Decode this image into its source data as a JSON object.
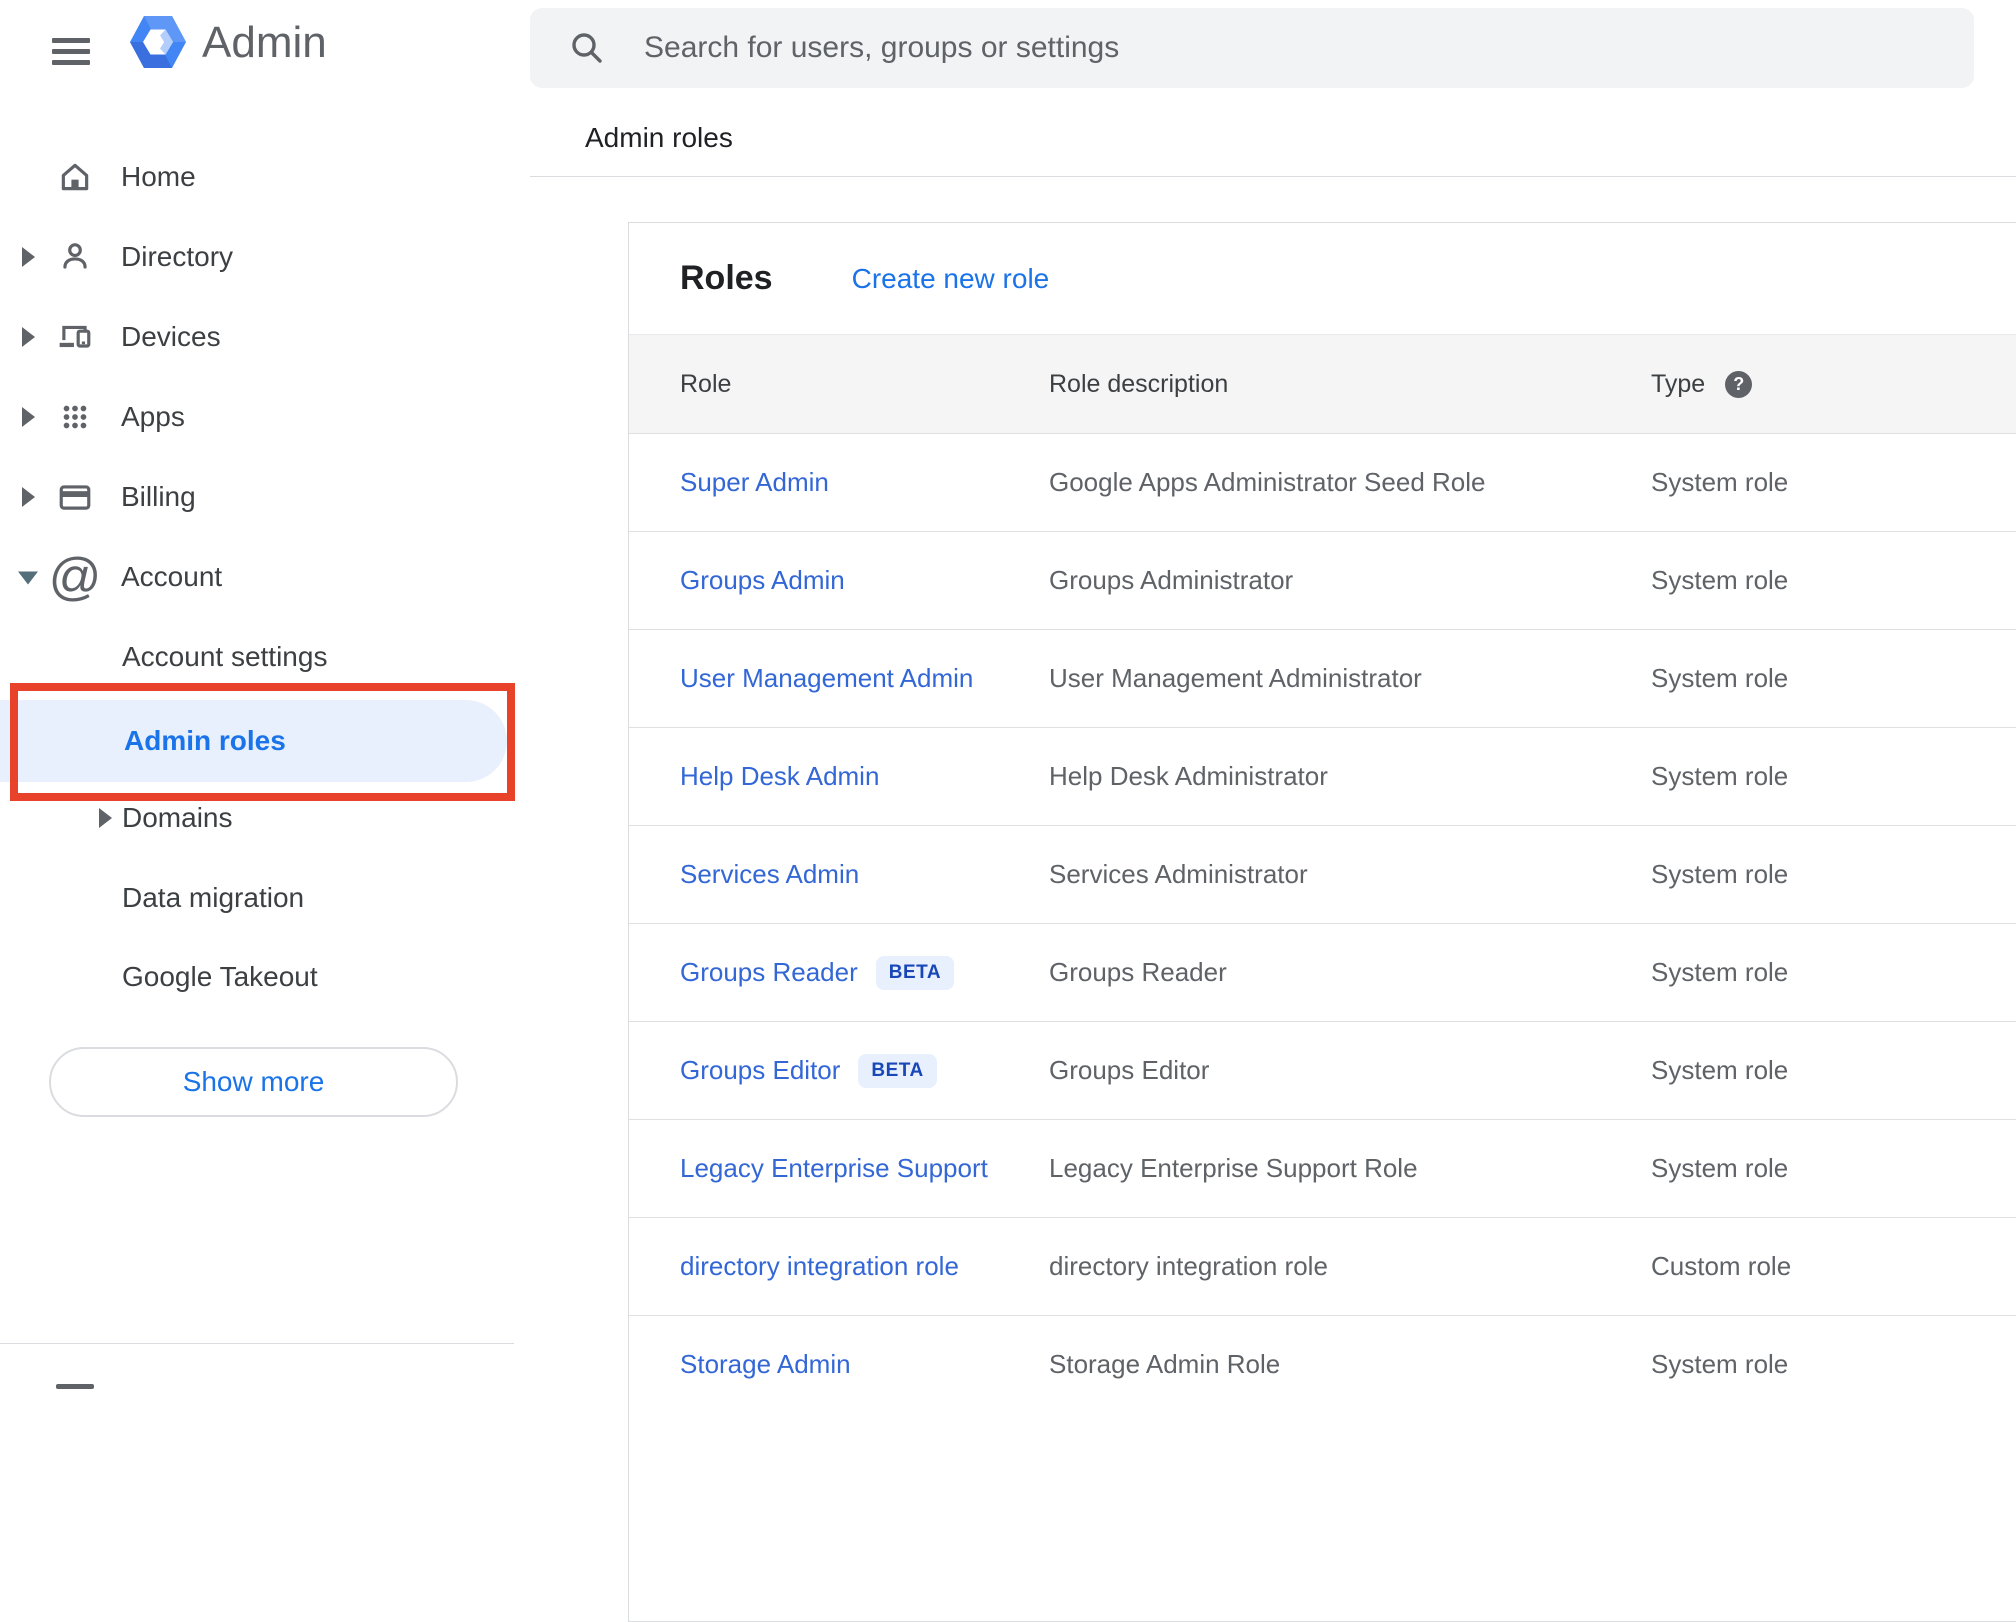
{
  "header": {
    "app_name": "Admin",
    "search_placeholder": "Search for users, groups or settings"
  },
  "breadcrumb": "Admin roles",
  "sidebar": {
    "items": [
      {
        "label": "Home",
        "icon": "home-icon"
      },
      {
        "label": "Directory",
        "icon": "person-icon"
      },
      {
        "label": "Devices",
        "icon": "devices-icon"
      },
      {
        "label": "Apps",
        "icon": "apps-grid-icon"
      },
      {
        "label": "Billing",
        "icon": "credit-card-icon"
      },
      {
        "label": "Account",
        "icon": "at-sign-icon"
      }
    ],
    "account_children": [
      {
        "label": "Account settings"
      },
      {
        "label": "Admin roles",
        "selected": true
      },
      {
        "label": "Domains"
      },
      {
        "label": "Data migration"
      },
      {
        "label": "Google Takeout"
      }
    ],
    "show_more_label": "Show more"
  },
  "roles_panel": {
    "title": "Roles",
    "create_link": "Create new role",
    "columns": {
      "role": "Role",
      "description": "Role description",
      "type": "Type"
    },
    "rows": [
      {
        "role": "Super Admin",
        "description": "Google Apps Administrator Seed Role",
        "type": "System role"
      },
      {
        "role": "Groups Admin",
        "description": "Groups Administrator",
        "type": "System role"
      },
      {
        "role": "User Management Admin",
        "description": "User Management Administrator",
        "type": "System role"
      },
      {
        "role": "Help Desk Admin",
        "description": "Help Desk Administrator",
        "type": "System role"
      },
      {
        "role": "Services Admin",
        "description": "Services Administrator",
        "type": "System role"
      },
      {
        "role": "Groups Reader",
        "badge": "BETA",
        "description": "Groups Reader",
        "type": "System role"
      },
      {
        "role": "Groups Editor",
        "badge": "BETA",
        "description": "Groups Editor",
        "type": "System role"
      },
      {
        "role": "Legacy Enterprise Support",
        "description": "Legacy Enterprise Support Role",
        "type": "System role"
      },
      {
        "role": "directory integration role",
        "description": "directory integration role",
        "type": "Custom role"
      },
      {
        "role": "Storage Admin",
        "description": "Storage Admin Role",
        "type": "System role"
      }
    ]
  },
  "colors": {
    "accent_blue": "#1a73e8",
    "row_link_blue": "#3367d6",
    "selected_item_bg": "#e8f0fe",
    "annotation_red": "#e8432a",
    "beta_badge_bg": "#e8f0fe",
    "beta_badge_text": "#1947b8",
    "searchbar_bg": "#f1f3f4",
    "table_header_bg": "#f5f5f5"
  }
}
